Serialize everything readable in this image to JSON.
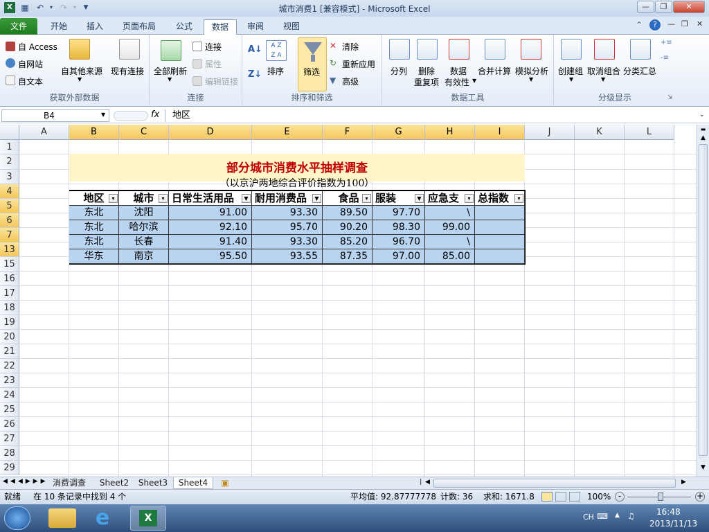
{
  "window": {
    "title": "城市消费1  [兼容模式]  -  Microsoft Excel"
  },
  "quick_access": {
    "save": "save-icon",
    "undo": "undo-icon",
    "redo": "redo-icon"
  },
  "tabs": [
    {
      "label": "文件"
    },
    {
      "label": "开始"
    },
    {
      "label": "插入"
    },
    {
      "label": "页面布局"
    },
    {
      "label": "公式"
    },
    {
      "label": "数据"
    },
    {
      "label": "审阅"
    },
    {
      "label": "视图"
    }
  ],
  "ribbon": {
    "external": {
      "access": "自 Access",
      "web": "自网站",
      "text": "自文本",
      "other": "自其他来源",
      "existing": "现有连接",
      "group": "获取外部数据"
    },
    "connections": {
      "refresh_all": "全部刷新",
      "connections": "连接",
      "properties": "属性",
      "edit_links": "编辑链接",
      "group": "连接"
    },
    "sortfilter": {
      "sort": "排序",
      "filter": "筛选",
      "clear": "清除",
      "reapply": "重新应用",
      "advanced": "高级",
      "group": "排序和筛选"
    },
    "datatools": {
      "text_to_columns": "分列",
      "remove_dup_1": "删除",
      "remove_dup_2": "重复项",
      "validation_1": "数据",
      "validation_2": "有效性",
      "consolidate": "合并计算",
      "whatif": "模拟分析",
      "group": "数据工具"
    },
    "outline": {
      "group_btn": "创建组",
      "ungroup": "取消组合",
      "subtotal": "分类汇总",
      "group": "分级显示"
    }
  },
  "formula_bar": {
    "name_box": "B4",
    "fx": "fx",
    "content": "地区"
  },
  "columns": [
    "A",
    "B",
    "C",
    "D",
    "E",
    "F",
    "G",
    "H",
    "I",
    "J",
    "K",
    "L"
  ],
  "rows": [
    "1",
    "2",
    "3",
    "4",
    "5",
    "6",
    "7",
    "13",
    "15",
    "16",
    "17",
    "18",
    "19",
    "20",
    "21",
    "22",
    "23",
    "24",
    "25",
    "26",
    "27",
    "28",
    "29"
  ],
  "sheet": {
    "title": "部分城市消费水平抽样调查",
    "subtitle": "（以京沪两地综合评价指数为100）",
    "headers": [
      "地区",
      "城市",
      "日常生活用品",
      "耐用消费品",
      "食品",
      "服装",
      "应急支",
      "总指数"
    ],
    "data": [
      [
        "东北",
        "沈阳",
        "91.00",
        "93.30",
        "89.50",
        "97.70",
        "\\",
        ""
      ],
      [
        "东北",
        "哈尔滨",
        "92.10",
        "95.70",
        "90.20",
        "98.30",
        "99.00",
        ""
      ],
      [
        "东北",
        "长春",
        "91.40",
        "93.30",
        "85.20",
        "96.70",
        "\\",
        ""
      ],
      [
        "华东",
        "南京",
        "95.50",
        "93.55",
        "87.35",
        "97.00",
        "85.00",
        ""
      ]
    ]
  },
  "sheet_tabs": [
    "消费调查",
    "Sheet2",
    "Sheet3",
    "Sheet4"
  ],
  "status": {
    "mode": "就绪",
    "filter_msg": "在 10 条记录中找到 4 个",
    "average": "平均值: 92.87777778",
    "count": "计数: 36",
    "sum": "求和: 1671.8",
    "zoom": "100%"
  },
  "taskbar": {
    "lang": "CH",
    "time": "16:48",
    "date": "2013/11/13"
  },
  "colors": {
    "accent": "#217346",
    "title_red": "#c00000",
    "data_fill": "#b8d4f0",
    "title_fill": "#fff5c8",
    "sel_header": "#f4c75a"
  }
}
